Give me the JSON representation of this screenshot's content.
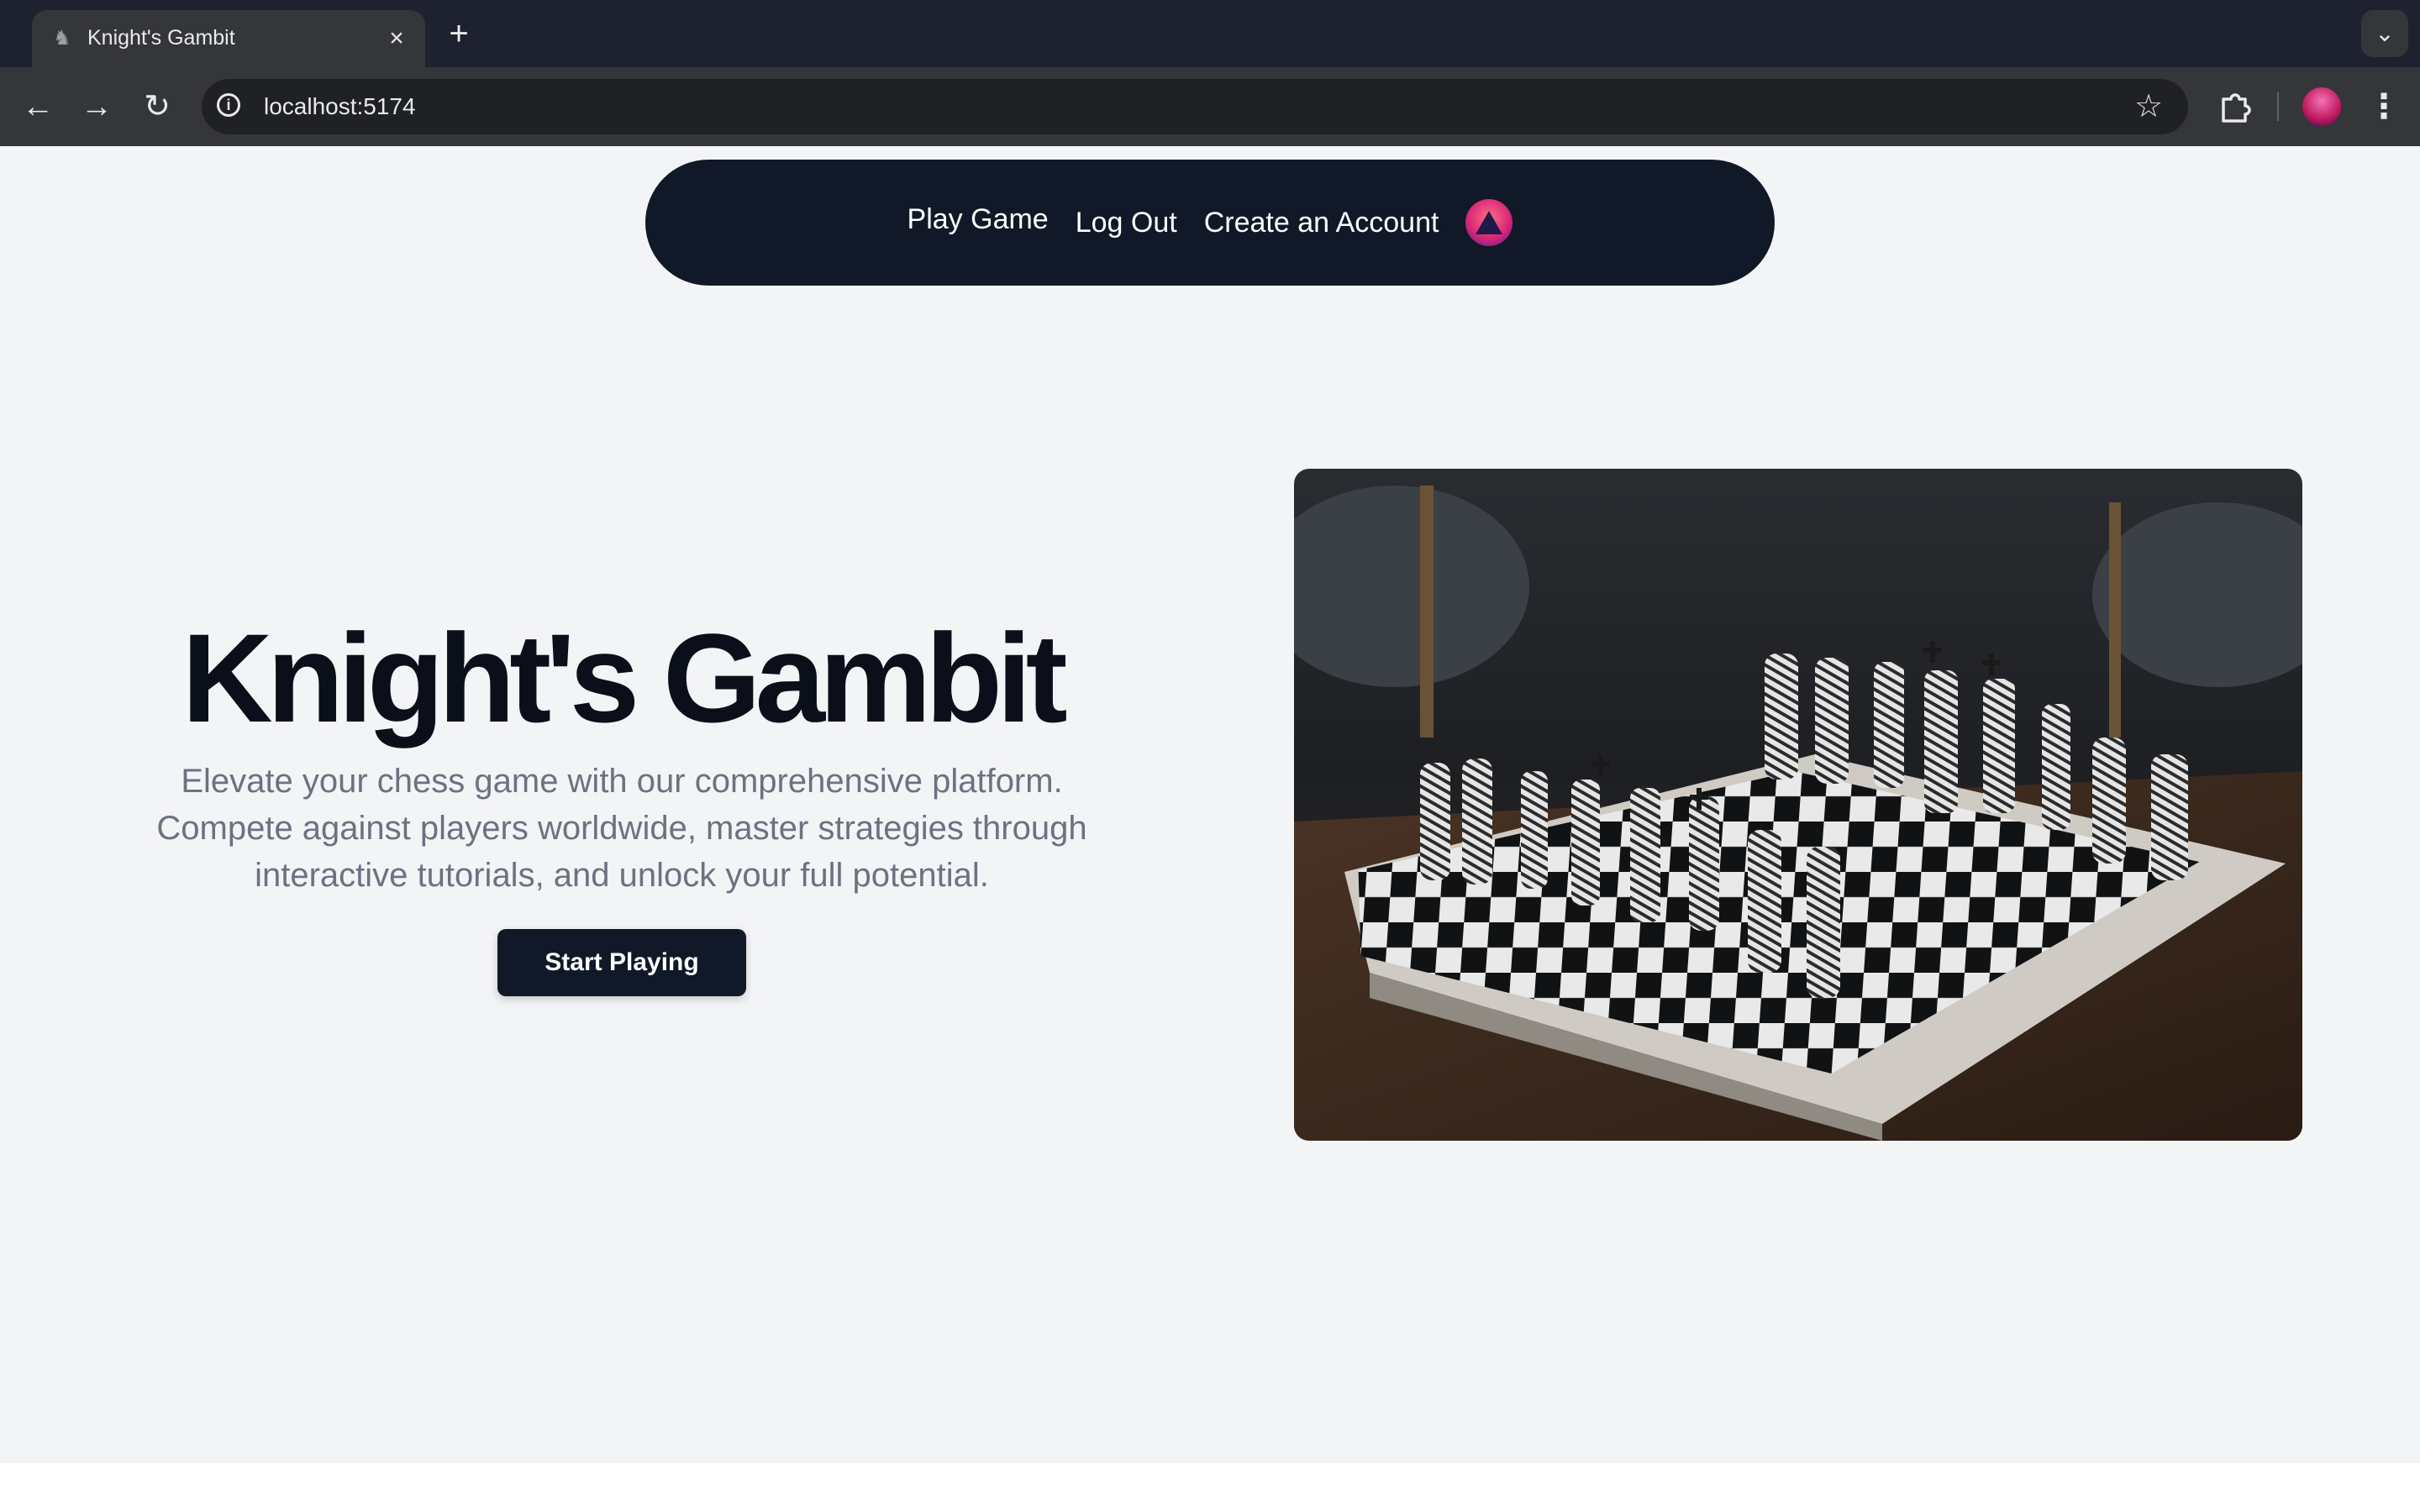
{
  "browser": {
    "tab_title": "Knight's Gambit",
    "tab_favicon": "chess-knight-icon",
    "url": "localhost:5174",
    "icons": {
      "back": "arrow-left-icon",
      "forward": "arrow-right-icon",
      "reload": "reload-icon",
      "site_info": "info-icon",
      "bookmark": "star-icon",
      "extensions": "puzzle-icon",
      "menu": "kebab-menu-icon"
    }
  },
  "nav": {
    "links": [
      "Play Game",
      "Log Out",
      "Create an Account"
    ],
    "avatar_icon": "user-avatar-icon"
  },
  "hero": {
    "title": "Knight's Gambit",
    "description": "Elevate your chess game with our comprehensive platform. Compete against players worldwide, master strategies through interactive tutorials, and unlock your full potential.",
    "cta": "Start Playing",
    "image_subject": "chessboard-photo"
  },
  "colors": {
    "page_bg": "#f3f4f6",
    "navbar_bg": "#111827",
    "title_text": "#0b0f1a",
    "body_text": "#6b7280",
    "button_bg": "#111827"
  }
}
